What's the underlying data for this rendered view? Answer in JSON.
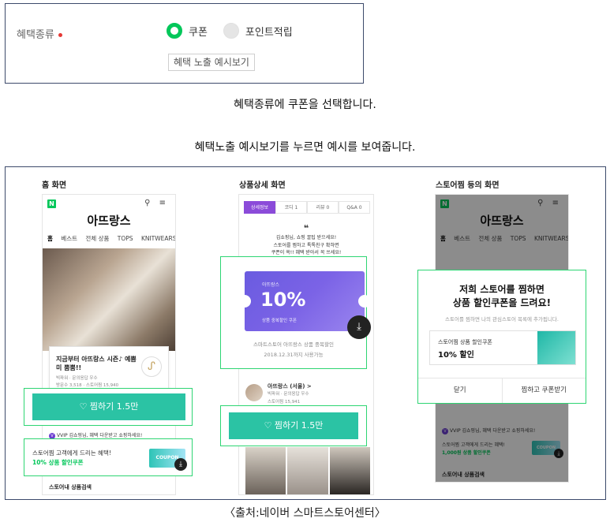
{
  "settings": {
    "field_label": "혜택종류",
    "option_coupon": "쿠폰",
    "option_point": "포인트적립",
    "preview_button": "혜택 노출 예시보기",
    "selected": "쿠폰"
  },
  "captions": {
    "line1": "혜택종류에 쿠폰을 선택합니다.",
    "line2": "혜택노출 예시보기를 누르면 예시를 보여줍니다."
  },
  "home": {
    "title": "홈 화면",
    "store_name": "아뜨랑스",
    "nav": [
      "홈",
      "베스트",
      "전체 상품",
      "TOPS",
      "KNITWEARS",
      "D"
    ],
    "promo_title": "지금부터 아뜨랑스 시즌♪ 예쁨 미 뿜뿜!!",
    "promo_meta1": "빅파워 · 문의응답 우수",
    "promo_meta2": "방문수 3,518 · 스토어찜 15,940",
    "zzim_label": "♡ 찜하기 1.5만",
    "vvip_text": "VVIP 김쇼핑님, 혜택 다운받고 쇼핑하세요!",
    "banner_line1": "스토어찜 고객에게 드리는 혜택!",
    "banner_line2": "10% 상품 할인쿠폰",
    "coupon_chip": "COUPON",
    "search_label": "스토어내 상품검색"
  },
  "detail": {
    "title": "상품상세 화면",
    "tabs": [
      "상세정보",
      "코디 1",
      "리뷰 0",
      "Q&A 0"
    ],
    "quote": "❝",
    "notice": [
      "김쇼핑님, 쇼핑 꿀팁 받으세요!",
      "스토어를 찜하고 톡톡친구 확하면",
      "쿠폰이 쏙!! 혜택 받아서 꼭 쓰세요!"
    ],
    "ticket_store": "아뜨랑스",
    "ticket_pct": "10%",
    "ticket_sub": "상품 중복할인 쿠폰",
    "coupon_desc1": "스마트스토어 아뜨랑스 상품 중복할인",
    "coupon_desc2": "2018.12.31까지 사용가능",
    "seller_name": "아뜨랑스 (서울) >",
    "seller_meta1": "빅파워 · 문의응답 우수",
    "seller_meta2": "스토어찜 15,941",
    "zzim_label": "♡ 찜하기 1.5만"
  },
  "storezzim": {
    "title": "스토어찜 등의 화면",
    "store_name": "아뜨랑스",
    "nav": [
      "홈",
      "베스트",
      "전체 상품",
      "TOPS",
      "KNITWEARS",
      "D"
    ],
    "modal_title1": "저희 스토어를 찜하면",
    "modal_title2": "상품 할인쿠폰을 드려요!",
    "modal_sub": "스토어를 찜하면 나의 관심스토어 목록에 추가됩니다.",
    "modal_coupon_line1": "스토어찜 상품 할인쿠폰",
    "modal_coupon_line2": "10% 할인",
    "btn_close": "닫기",
    "btn_get": "찜하고 쿠폰받기",
    "vvip_text": "VVIP 김쇼핑님, 혜택 다운받고 쇼핑하세요!",
    "banner_line1": "스토어찜 고객에게 드리는 혜택!",
    "banner_line2": "1,000원 상품 할인쿠폰",
    "coupon_chip": "COUPON",
    "search_label": "스토어내 상품검색"
  },
  "source": "〈출처:네이버 스마트스토어센터〉",
  "colors": {
    "accent": "#03c75a",
    "highlight": "#2ed573",
    "zzim": "#2bc3a4",
    "tab_active": "#8b4bd9"
  }
}
